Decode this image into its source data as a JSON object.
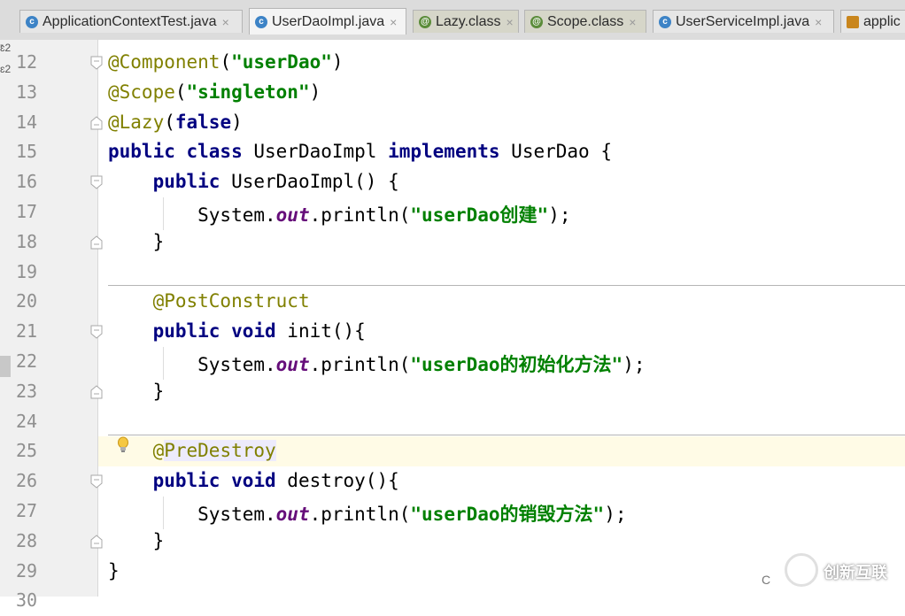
{
  "tabs": [
    {
      "label": "ApplicationContextTest.java",
      "icon": "c",
      "close": "×"
    },
    {
      "label": "UserDaoImpl.java",
      "icon": "c",
      "close": "×"
    },
    {
      "label": "Lazy.class",
      "icon": "a",
      "close": "×"
    },
    {
      "label": "Scope.class",
      "icon": "a",
      "close": "×"
    },
    {
      "label": "UserServiceImpl.java",
      "icon": "c",
      "close": "×"
    },
    {
      "label": "applic",
      "icon": "x",
      "close": ""
    }
  ],
  "left_strip": {
    "mark1": "ɛ2",
    "mark2": "ɛ2",
    "mark0": "-"
  },
  "lines": [
    {
      "num": "12",
      "tokens": [
        {
          "t": "@Component",
          "c": "ann"
        },
        {
          "t": "(",
          "c": ""
        },
        {
          "t": "\"userDao\"",
          "c": "str"
        },
        {
          "t": ")",
          "c": ""
        }
      ]
    },
    {
      "num": "13",
      "tokens": [
        {
          "t": "@Scope",
          "c": "ann"
        },
        {
          "t": "(",
          "c": ""
        },
        {
          "t": "\"singleton\"",
          "c": "str"
        },
        {
          "t": ")",
          "c": ""
        }
      ]
    },
    {
      "num": "14",
      "tokens": [
        {
          "t": "@Lazy",
          "c": "ann"
        },
        {
          "t": "(",
          "c": ""
        },
        {
          "t": "false",
          "c": "kw"
        },
        {
          "t": ")",
          "c": ""
        }
      ]
    },
    {
      "num": "15",
      "tokens": [
        {
          "t": "public class ",
          "c": "kw"
        },
        {
          "t": "UserDaoImpl ",
          "c": ""
        },
        {
          "t": "implements ",
          "c": "kw"
        },
        {
          "t": "UserDao {",
          "c": ""
        }
      ]
    },
    {
      "num": "16",
      "tokens": [
        {
          "t": "    ",
          "c": ""
        },
        {
          "t": "public ",
          "c": "kw"
        },
        {
          "t": "UserDaoImpl() {",
          "c": ""
        }
      ]
    },
    {
      "num": "17",
      "tokens": [
        {
          "t": "        System.",
          "c": ""
        },
        {
          "t": "out",
          "c": "fld"
        },
        {
          "t": ".println(",
          "c": ""
        },
        {
          "t": "\"userDao创建\"",
          "c": "str"
        },
        {
          "t": ");",
          "c": ""
        }
      ]
    },
    {
      "num": "18",
      "tokens": [
        {
          "t": "    }",
          "c": ""
        }
      ]
    },
    {
      "num": "19",
      "tokens": []
    },
    {
      "num": "20",
      "tokens": [
        {
          "t": "    ",
          "c": ""
        },
        {
          "t": "@PostConstruct",
          "c": "ann"
        }
      ]
    },
    {
      "num": "21",
      "tokens": [
        {
          "t": "    ",
          "c": ""
        },
        {
          "t": "public void ",
          "c": "kw"
        },
        {
          "t": "init(){",
          "c": ""
        }
      ]
    },
    {
      "num": "22",
      "tokens": [
        {
          "t": "        System.",
          "c": ""
        },
        {
          "t": "out",
          "c": "fld"
        },
        {
          "t": ".println(",
          "c": ""
        },
        {
          "t": "\"userDao的初始化方法\"",
          "c": "str"
        },
        {
          "t": ");",
          "c": ""
        }
      ]
    },
    {
      "num": "23",
      "tokens": [
        {
          "t": "    }",
          "c": ""
        }
      ]
    },
    {
      "num": "24",
      "tokens": []
    },
    {
      "num": "25",
      "tokens": [
        {
          "t": "    ",
          "c": ""
        },
        {
          "t": "@",
          "c": "ann"
        },
        {
          "t": "PreDestroy",
          "c": "ann hl"
        }
      ]
    },
    {
      "num": "26",
      "tokens": [
        {
          "t": "    ",
          "c": ""
        },
        {
          "t": "public void ",
          "c": "kw"
        },
        {
          "t": "destroy(){",
          "c": ""
        }
      ]
    },
    {
      "num": "27",
      "tokens": [
        {
          "t": "        System.",
          "c": ""
        },
        {
          "t": "out",
          "c": "fld"
        },
        {
          "t": ".println(",
          "c": ""
        },
        {
          "t": "\"userDao的销毁方法\"",
          "c": "str"
        },
        {
          "t": ");",
          "c": ""
        }
      ]
    },
    {
      "num": "28",
      "tokens": [
        {
          "t": "    }",
          "c": ""
        }
      ]
    },
    {
      "num": "29",
      "tokens": [
        {
          "t": "}",
          "c": ""
        }
      ]
    },
    {
      "num": "30",
      "tokens": []
    }
  ],
  "current_line": "25",
  "watermark": {
    "prefix": "C",
    "text": "创新互联"
  },
  "colors": {
    "annotation": "#808000",
    "keyword": "#000080",
    "string": "#008000",
    "field": "#660e7a",
    "line_number": "#8f8f8f",
    "current_line_bg": "#fffbe6"
  }
}
